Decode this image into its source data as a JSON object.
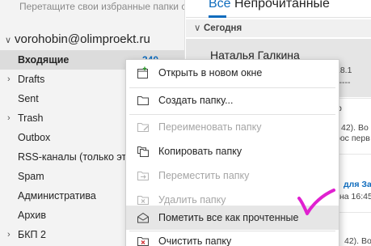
{
  "folders_pane": {
    "favorites_hint": "Перетащите свои избранные папки с",
    "account": "vorohobin@olimproekt.ru",
    "folders": [
      {
        "label": "Входящие",
        "count": "340",
        "selected": true,
        "expandable": false
      },
      {
        "label": "Drafts",
        "expandable": true
      },
      {
        "label": "Sent",
        "expandable": false
      },
      {
        "label": "Trash",
        "expandable": true
      },
      {
        "label": "Outbox",
        "expandable": false
      },
      {
        "label": "RSS-каналы (только этот",
        "expandable": false
      },
      {
        "label": "Spam",
        "expandable": false
      },
      {
        "label": "Административа",
        "expandable": false
      },
      {
        "label": "Архив",
        "expandable": false
      },
      {
        "label": "БКП 2",
        "expandable": true
      }
    ]
  },
  "message_pane": {
    "tabs": [
      "Все",
      "Непрочитанные"
    ],
    "group_header": "Сегодня",
    "sender": "Наталья Галкина",
    "fragments": {
      "time": "18.1",
      "dash": "-----",
      "b": "b",
      "frag1": "(в 42). Во",
      "frag2": "рос перв",
      "frag3": "для За",
      "frag4": "на 16:45",
      "frag5": "42). Во"
    }
  },
  "context_menu": {
    "items": [
      {
        "label": "Открыть в новом окне",
        "icon": "open-in-new-window-icon",
        "disabled": false
      },
      {
        "label": "Создать папку...",
        "icon": "new-folder-icon",
        "disabled": false
      },
      {
        "label": "Переименовать папку",
        "icon": "rename-folder-icon",
        "disabled": true
      },
      {
        "label": "Копировать папку",
        "icon": "copy-folder-icon",
        "disabled": false
      },
      {
        "label": "Переместить папку",
        "icon": "move-folder-icon",
        "disabled": true
      },
      {
        "label": "Удалить папку",
        "icon": "delete-folder-icon",
        "disabled": true
      },
      {
        "label": "Пометить все как прочтенные",
        "icon": "mark-all-read-icon",
        "disabled": false,
        "highlighted": true
      },
      {
        "label": "Очистить папку",
        "icon": "empty-folder-icon",
        "disabled": false
      }
    ]
  },
  "colors": {
    "accent": "#0f6cbd",
    "annotation": "#e020d0",
    "disabled_text": "#a6a6a6"
  }
}
